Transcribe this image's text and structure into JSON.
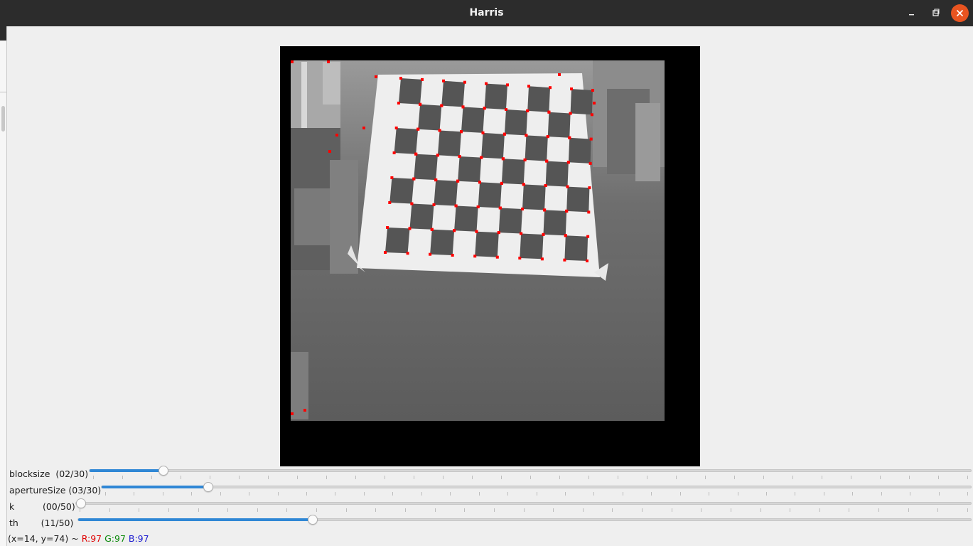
{
  "window": {
    "title": "Harris",
    "titlebar_color": "#2c2c2c",
    "close_color": "#e95420"
  },
  "trackbars": [
    {
      "id": "blocksize",
      "label": "blocksize  (02/30)",
      "value": 2,
      "max": 30
    },
    {
      "id": "aperturesize",
      "label": "apertureSize (03/30)",
      "value": 3,
      "max": 30
    },
    {
      "id": "k",
      "label": "k          (00/50)",
      "value": 0,
      "max": 50
    },
    {
      "id": "th",
      "label": "th        (11/50)",
      "value": 11,
      "max": 50
    }
  ],
  "status": {
    "coords": "(x=14, y=74) ~ ",
    "r": "R:97",
    "g": "G:97",
    "b": "B:97"
  },
  "colors": {
    "accent": "#2f87d5",
    "corner_marker": "#ff0000",
    "image_background": "#000000"
  }
}
